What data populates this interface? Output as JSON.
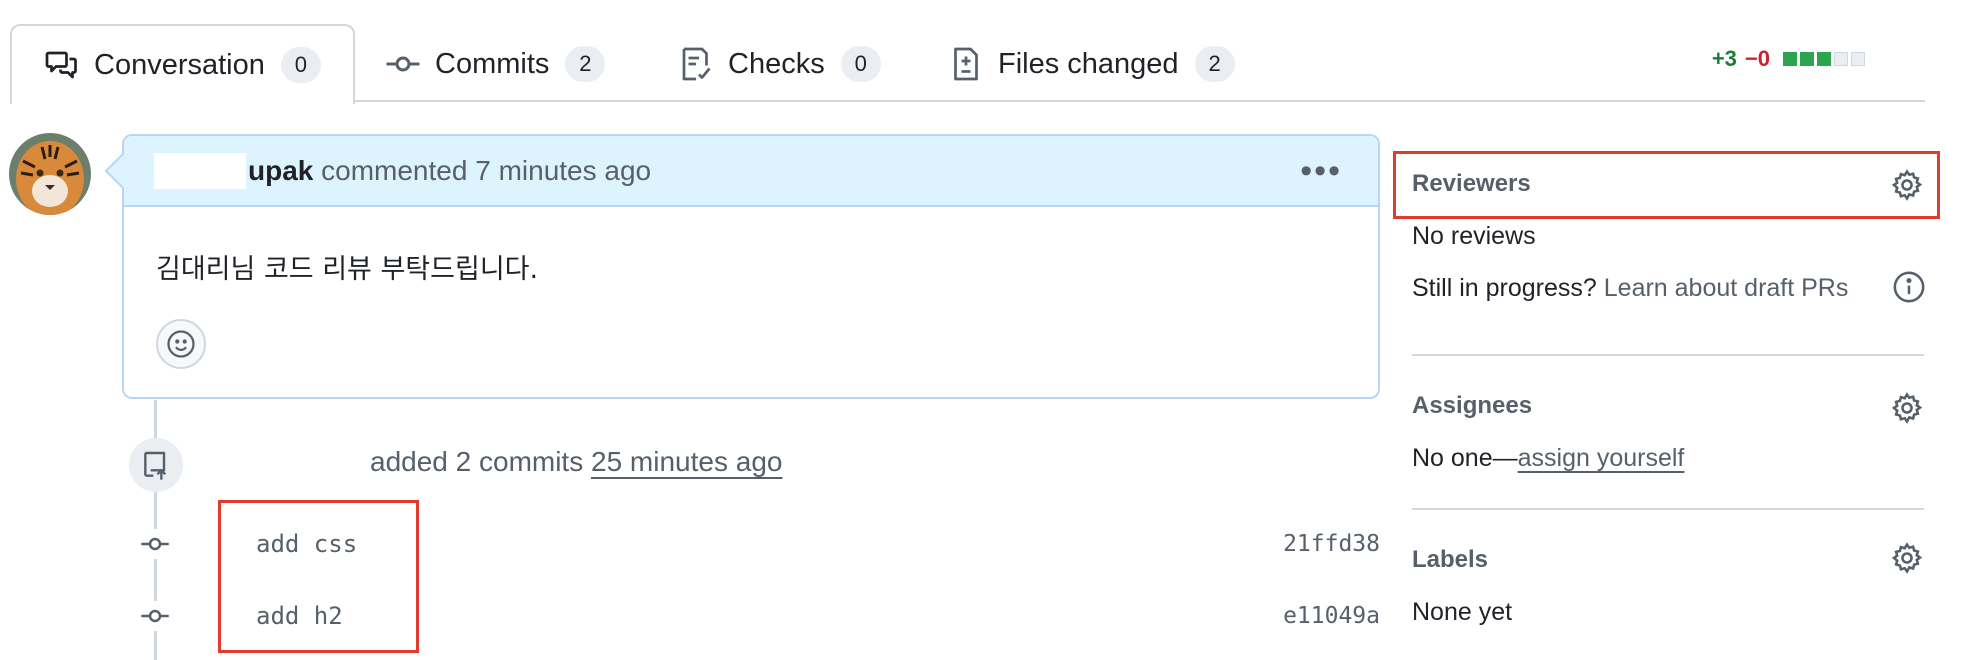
{
  "tabs": [
    {
      "label": "Conversation",
      "count": "0",
      "icon": "comment-discussion-icon"
    },
    {
      "label": "Commits",
      "count": "2",
      "icon": "git-commit-icon"
    },
    {
      "label": "Checks",
      "count": "0",
      "icon": "checklist-icon"
    },
    {
      "label": "Files changed",
      "count": "2",
      "icon": "file-diff-icon"
    }
  ],
  "diffstat": {
    "additions": "+3",
    "deletions": "−0",
    "blocks": [
      "#2da44e",
      "#2da44e",
      "#2da44e",
      "#d0d7de",
      "#d0d7de"
    ]
  },
  "comment": {
    "author": "upak",
    "action": "commented",
    "time": "7 minutes ago",
    "body": "김대리님 코드 리뷰 부탁드립니다."
  },
  "timeline": {
    "push_text": "added 2 commits",
    "push_time": "25 minutes ago",
    "commits": [
      {
        "message": "add css",
        "sha": "21ffd38"
      },
      {
        "message": "add h2",
        "sha": "e11049a"
      }
    ]
  },
  "sidebar": {
    "reviewers": {
      "title": "Reviewers",
      "empty": "No reviews",
      "draft_prompt": "Still in progress?",
      "draft_link": "Learn about draft PRs"
    },
    "assignees": {
      "title": "Assignees",
      "empty": "No one—",
      "assign_link": "assign yourself"
    },
    "labels": {
      "title": "Labels",
      "empty": "None yet"
    }
  },
  "colors": {
    "accent_red": "#e03c2e",
    "added": "#1a7f37",
    "deleted": "#cf222e",
    "comment_header": "#ddf4ff"
  }
}
